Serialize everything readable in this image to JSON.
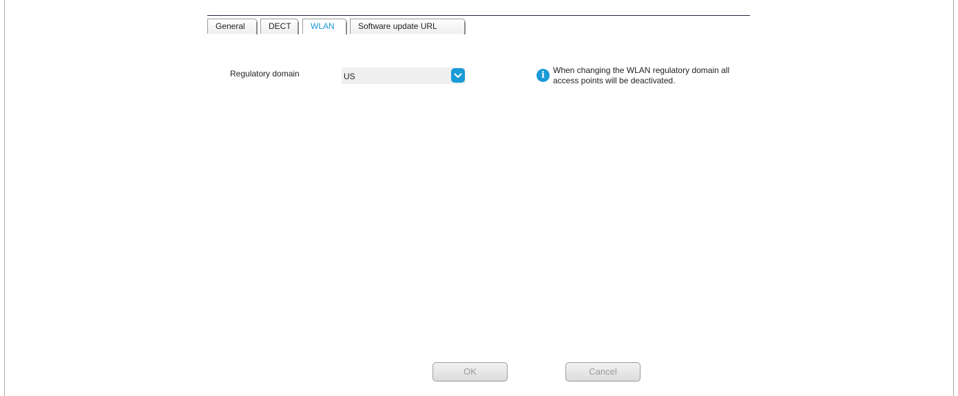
{
  "tabs": [
    {
      "label": "General"
    },
    {
      "label": "DECT"
    },
    {
      "label": "WLAN",
      "active": true
    },
    {
      "label": "Software update URL"
    }
  ],
  "form": {
    "regulatory_domain_label": "Regulatory domain",
    "regulatory_domain_value": "US",
    "info_text": "When changing the WLAN regulatory domain all access points will be deactivated."
  },
  "buttons": {
    "ok_label": "OK",
    "cancel_label": "Cancel"
  },
  "colors": {
    "accent": "#1a9ad6"
  },
  "icons": {
    "dropdown": "chevron-down-icon",
    "info": "info-icon"
  }
}
